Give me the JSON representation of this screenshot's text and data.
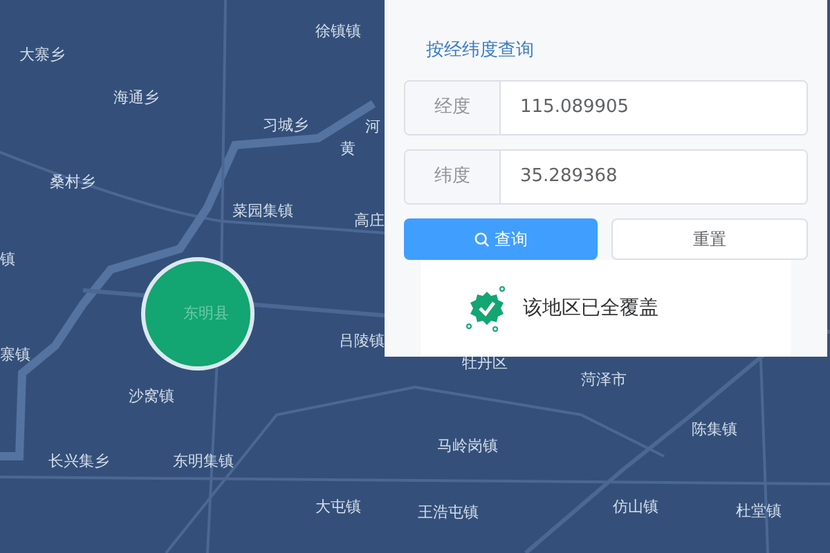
{
  "map": {
    "labels": [
      {
        "text": "徐镇镇"
      },
      {
        "text": "大寨乡"
      },
      {
        "text": "海通乡"
      },
      {
        "text": "习城乡"
      },
      {
        "text": "河"
      },
      {
        "text": "黄"
      },
      {
        "text": "桑村乡"
      },
      {
        "text": "菜园集镇"
      },
      {
        "text": "高庄"
      },
      {
        "text": "镇"
      },
      {
        "text": "吕陵镇"
      },
      {
        "text": "寨镇"
      },
      {
        "text": "沙窝镇"
      },
      {
        "text": "长兴集乡"
      },
      {
        "text": "东明集镇"
      },
      {
        "text": "大屯镇"
      },
      {
        "text": "牡丹区"
      },
      {
        "text": "菏泽市"
      },
      {
        "text": "陈集镇"
      },
      {
        "text": "马岭岗镇"
      },
      {
        "text": "王浩屯镇"
      },
      {
        "text": "仿山镇"
      },
      {
        "text": "杜堂镇"
      }
    ],
    "marker": {
      "label": "东明县"
    }
  },
  "panel": {
    "title": "按经纬度查询",
    "fields": [
      {
        "label": "经度",
        "value": "115.089905"
      },
      {
        "label": "纬度",
        "value": "35.289368"
      }
    ],
    "buttons": [
      {
        "kind": "primary",
        "label": "查询"
      },
      {
        "kind": "default",
        "label": "重置"
      }
    ],
    "result": {
      "text": "该地区已全覆盖"
    }
  }
}
